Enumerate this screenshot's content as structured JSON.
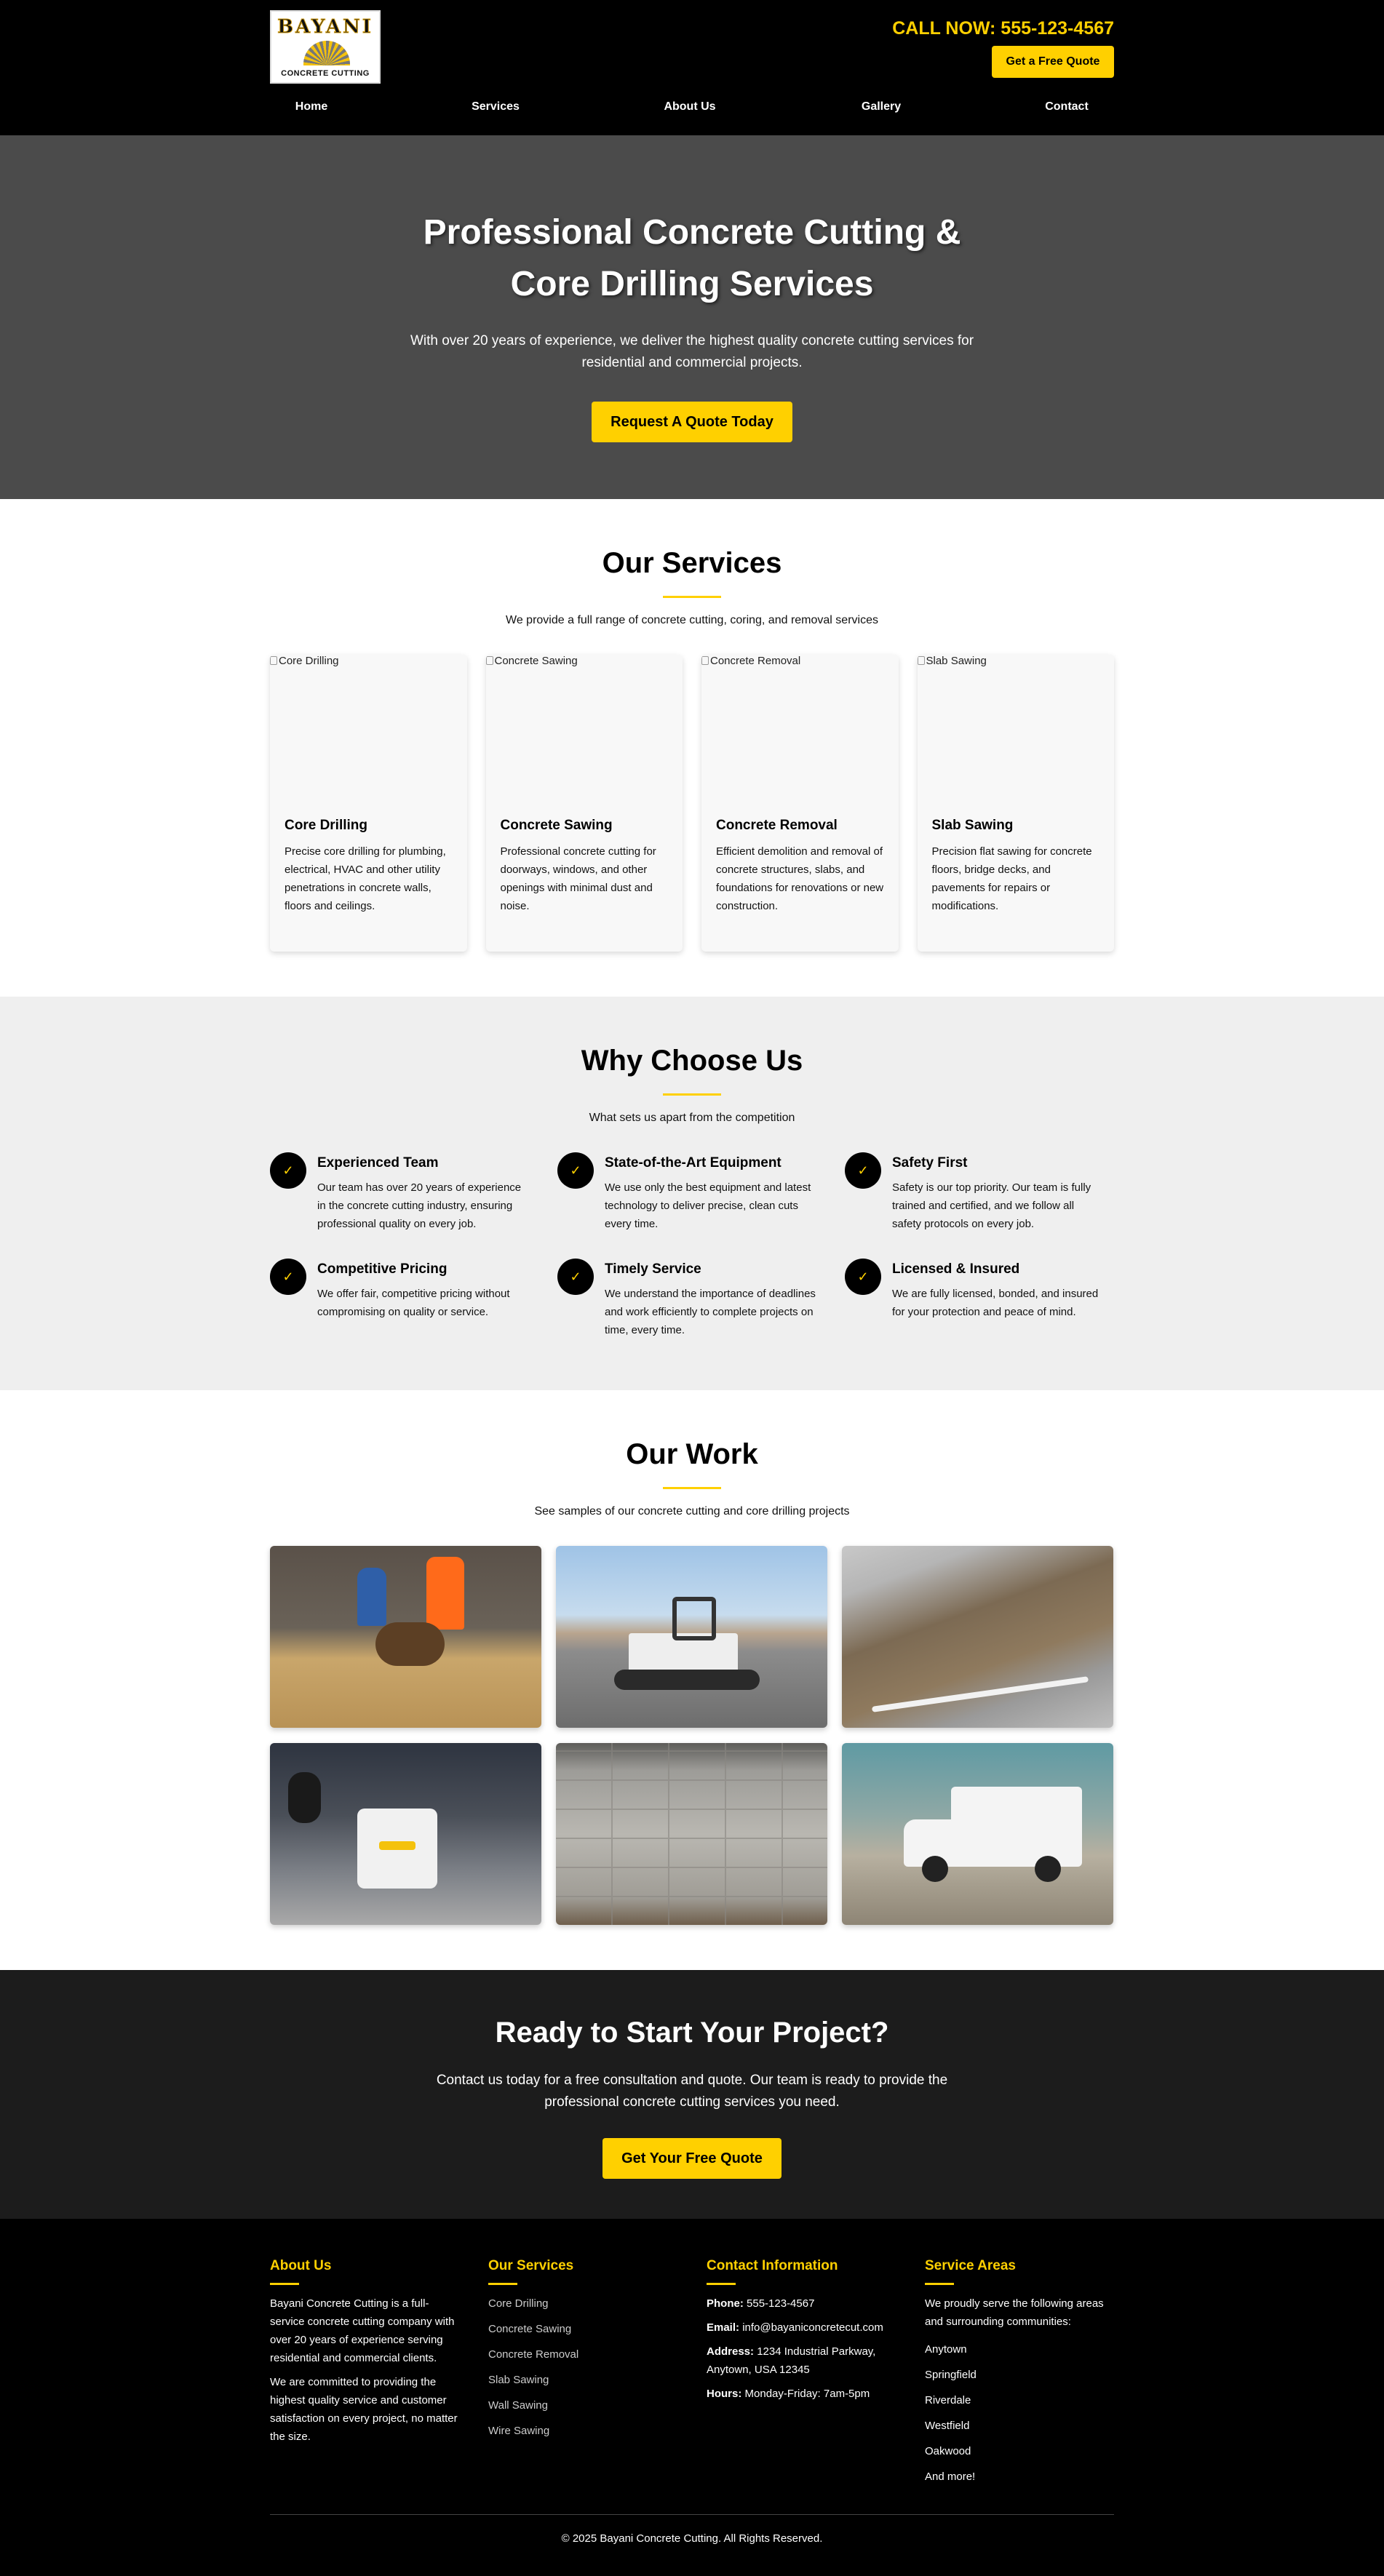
{
  "header": {
    "logo_name": "BAYANI",
    "logo_sub": "CONCRETE CUTTING",
    "call": "CALL NOW: 555-123-4567",
    "quote_button": "Get a Free Quote",
    "nav": [
      "Home",
      "Services",
      "About Us",
      "Gallery",
      "Contact"
    ]
  },
  "hero": {
    "title": "Professional Concrete Cutting & Core Drilling Services",
    "text": "With over 20 years of experience, we deliver the highest quality concrete cutting services for residential and commercial projects.",
    "button": "Request A Quote Today"
  },
  "services": {
    "title": "Our Services",
    "subtitle": "We provide a full range of concrete cutting, coring, and removal services",
    "cards": [
      {
        "alt": "Core Drilling",
        "title": "Core Drilling",
        "text": "Precise core drilling for plumbing, electrical, HVAC and other utility penetrations in concrete walls, floors and ceilings."
      },
      {
        "alt": "Concrete Sawing",
        "title": "Concrete Sawing",
        "text": "Professional concrete cutting for doorways, windows, and other openings with minimal dust and noise."
      },
      {
        "alt": "Concrete Removal",
        "title": "Concrete Removal",
        "text": "Efficient demolition and removal of concrete structures, slabs, and foundations for renovations or new construction."
      },
      {
        "alt": "Slab Sawing",
        "title": "Slab Sawing",
        "text": "Precision flat sawing for concrete floors, bridge decks, and pavements for repairs or modifications."
      }
    ]
  },
  "why": {
    "title": "Why Choose Us",
    "subtitle": "What sets us apart from the competition",
    "check": "✓",
    "features": [
      {
        "title": "Experienced Team",
        "text": "Our team has over 20 years of experience in the concrete cutting industry, ensuring professional quality on every job."
      },
      {
        "title": "State-of-the-Art Equipment",
        "text": "We use only the best equipment and latest technology to deliver precise, clean cuts every time."
      },
      {
        "title": "Safety First",
        "text": "Safety is our top priority. Our team is fully trained and certified, and we follow all safety protocols on every job."
      },
      {
        "title": "Competitive Pricing",
        "text": "We offer fair, competitive pricing without compromising on quality or service."
      },
      {
        "title": "Timely Service",
        "text": "We understand the importance of deadlines and work efficiently to complete projects on time, every time."
      },
      {
        "title": "Licensed & Insured",
        "text": "We are fully licensed, bonded, and insured for your protection and peace of mind."
      }
    ]
  },
  "work": {
    "title": "Our Work",
    "subtitle": "See samples of our concrete cutting and core drilling projects"
  },
  "cta": {
    "title": "Ready to Start Your Project?",
    "text": "Contact us today for a free consultation and quote. Our team is ready to provide the professional concrete cutting services you need.",
    "button": "Get Your Free Quote"
  },
  "footer": {
    "about": {
      "title": "About Us",
      "p1": "Bayani Concrete Cutting is a full-service concrete cutting company with over 20 years of experience serving residential and commercial clients.",
      "p2": "We are committed to providing the highest quality service and customer satisfaction on every project, no matter the size."
    },
    "services": {
      "title": "Our Services",
      "items": [
        "Core Drilling",
        "Concrete Sawing",
        "Concrete Removal",
        "Slab Sawing",
        "Wall Sawing",
        "Wire Sawing"
      ]
    },
    "contact": {
      "title": "Contact Information",
      "phone_label": "Phone:",
      "phone": "555-123-4567",
      "email_label": "Email:",
      "email": "info@bayaniconcretecut.com",
      "address_label": "Address:",
      "address": "1234 Industrial Parkway, Anytown, USA 12345",
      "hours_label": "Hours:",
      "hours": "Monday-Friday: 7am-5pm"
    },
    "areas": {
      "title": "Service Areas",
      "intro": "We proudly serve the following areas and surrounding communities:",
      "items": [
        "Anytown",
        "Springfield",
        "Riverdale",
        "Westfield",
        "Oakwood",
        "And more!"
      ]
    },
    "copyright": "© 2025 Bayani Concrete Cutting. All Rights Reserved."
  }
}
